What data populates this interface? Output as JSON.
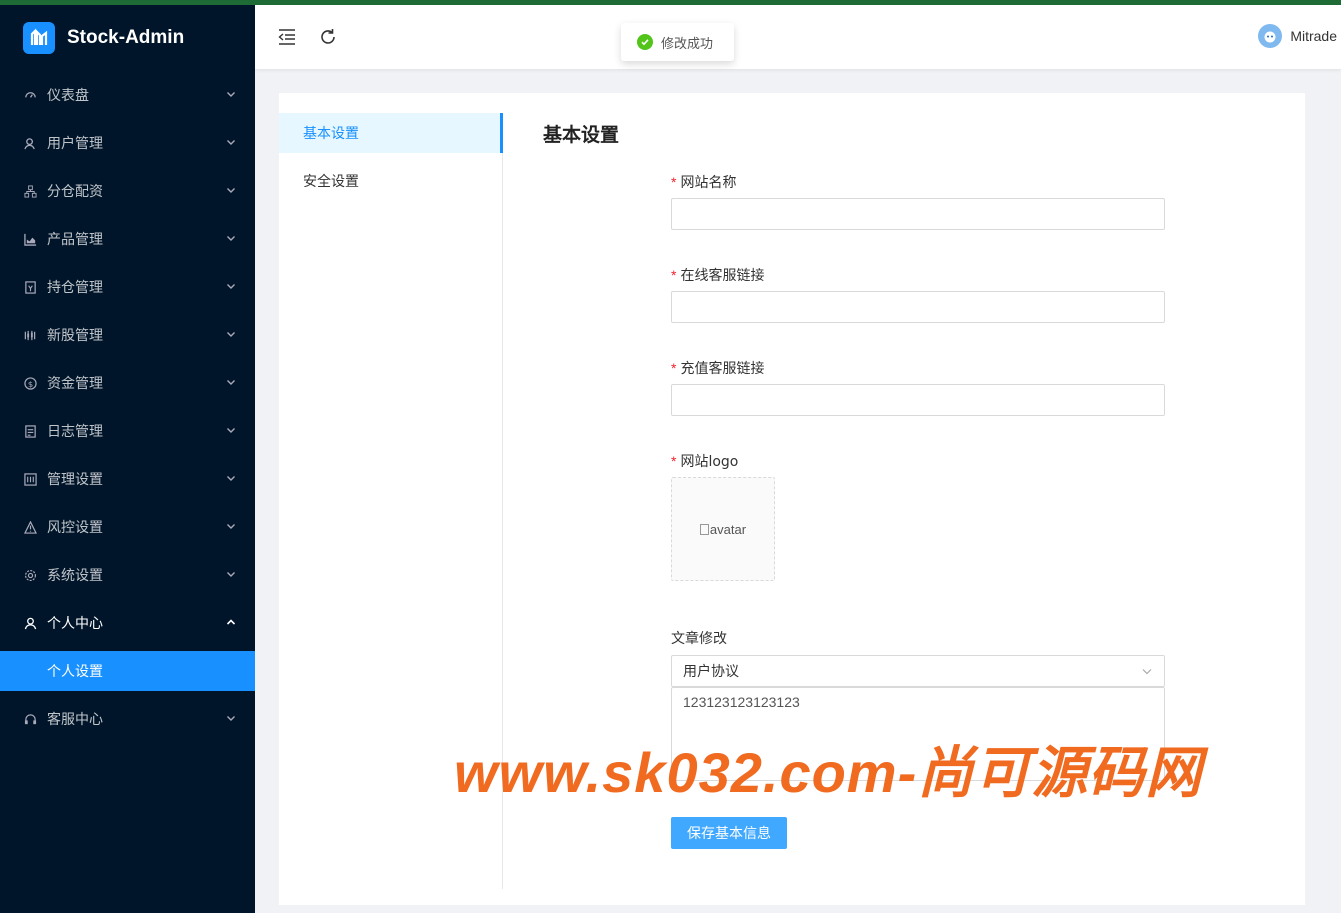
{
  "app": {
    "title": "Stock-Admin"
  },
  "sidebar": {
    "items": [
      {
        "label": "仪表盘",
        "icon": "dashboard-icon"
      },
      {
        "label": "用户管理",
        "icon": "user-manage-icon"
      },
      {
        "label": "分仓配资",
        "icon": "cluster-icon"
      },
      {
        "label": "产品管理",
        "icon": "area-chart-icon"
      },
      {
        "label": "持仓管理",
        "icon": "position-icon"
      },
      {
        "label": "新股管理",
        "icon": "new-stock-icon"
      },
      {
        "label": "资金管理",
        "icon": "dollar-icon"
      },
      {
        "label": "日志管理",
        "icon": "log-icon"
      },
      {
        "label": "管理设置",
        "icon": "admin-settings-icon"
      },
      {
        "label": "风控设置",
        "icon": "warning-icon"
      },
      {
        "label": "系统设置",
        "icon": "gear-icon"
      },
      {
        "label": "个人中心",
        "icon": "user-icon",
        "open": true
      },
      {
        "label": "客服中心",
        "icon": "headset-icon"
      }
    ],
    "subitem": {
      "label": "个人设置"
    }
  },
  "header": {
    "username": "Mitrade"
  },
  "toast": {
    "message": "修改成功"
  },
  "subnav": {
    "items": [
      "基本设置",
      "安全设置"
    ]
  },
  "form": {
    "title": "基本设置",
    "site_name_label": "网站名称",
    "online_service_label": "在线客服链接",
    "recharge_service_label": "充值客服链接",
    "logo_label": "网站logo",
    "logo_alt": "avatar",
    "article_label": "文章修改",
    "article_selected": "用户协议",
    "article_content": "123123123123123",
    "save_label": "保存基本信息"
  },
  "watermark": "www.sk032.com-尚可源码网",
  "colors": {
    "sidebar": "#001529",
    "accent": "#1890ff",
    "success": "#52c41a",
    "watermark": "#f06a20"
  }
}
